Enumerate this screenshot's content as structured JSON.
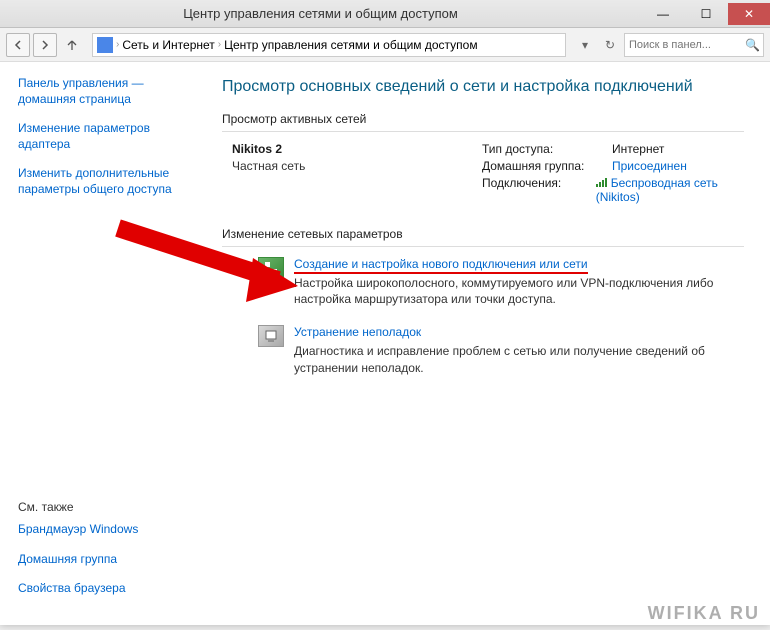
{
  "title": "Центр управления сетями и общим доступом",
  "breadcrumb": {
    "item1": "Сеть и Интернет",
    "item2": "Центр управления сетями и общим доступом"
  },
  "search": {
    "placeholder": "Поиск в панел..."
  },
  "sidebar": {
    "link1": "Панель управления — домашняя страница",
    "link2": "Изменение параметров адаптера",
    "link3": "Изменить дополнительные параметры общего доступа",
    "see_also": "См. также",
    "extra1": "Брандмауэр Windows",
    "extra2": "Домашняя группа",
    "extra3": "Свойства браузера"
  },
  "main": {
    "heading": "Просмотр основных сведений о сети и настройка подключений",
    "section1": "Просмотр активных сетей",
    "network": {
      "name": "Nikitos 2",
      "type": "Частная сеть",
      "access_label": "Тип доступа:",
      "access_val": "Интернет",
      "homegroup_label": "Домашняя группа:",
      "homegroup_val": "Присоединен",
      "conn_label": "Подключения:",
      "conn_val": "Беспроводная сеть (Nikitos)"
    },
    "section2": "Изменение сетевых параметров",
    "action1": {
      "title": "Создание и настройка нового подключения или сети",
      "desc": "Настройка широкополосного, коммутируемого или VPN-подключения либо настройка маршрутизатора или точки доступа."
    },
    "action2": {
      "title": "Устранение неполадок",
      "desc": "Диагностика и исправление проблем с сетью или получение сведений об устранении неполадок."
    }
  },
  "watermark": "WIFIKA RU"
}
